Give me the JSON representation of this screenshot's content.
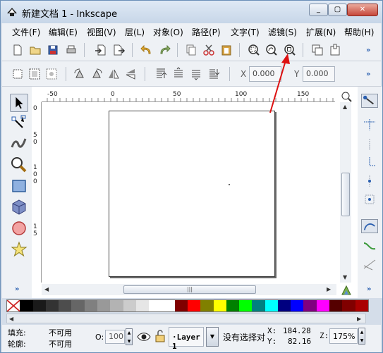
{
  "window": {
    "title": "新建文档 1 - Inkscape"
  },
  "window_buttons": {
    "minimize": "_",
    "maximize": "▢",
    "close": "✕"
  },
  "menu": [
    {
      "label": "文件(F)"
    },
    {
      "label": "编辑(E)"
    },
    {
      "label": "视图(V)"
    },
    {
      "label": "层(L)"
    },
    {
      "label": "对象(O)"
    },
    {
      "label": "路径(P)"
    },
    {
      "label": "文字(T)"
    },
    {
      "label": "滤镜(S)"
    },
    {
      "label": "扩展(N)"
    },
    {
      "label": "帮助(H)"
    }
  ],
  "toolbar_more": "»",
  "controls": {
    "x_label": "X",
    "x_value": "0.000",
    "y_label": "Y",
    "y_value": "0.000"
  },
  "rulers": {
    "horizontal": [
      "-50",
      "0",
      "50",
      "100",
      "150"
    ],
    "vertical": [
      "0",
      "5",
      "0",
      "1",
      "0",
      "0",
      "1",
      "5"
    ]
  },
  "status": {
    "fill_label": "填充:",
    "fill_value": "不可用",
    "stroke_label": "轮廓:",
    "stroke_value": "不可用",
    "opacity_label": "O:",
    "opacity_value": "100",
    "layer_name": "·Layer 1",
    "message": "没有选择对",
    "x_label": "X:",
    "x_coord": "184.28",
    "y_label": "Y:",
    "y_coord": "82.16",
    "zoom_label": "Z:",
    "zoom_value": "175%"
  },
  "palette_colors": [
    "#000000",
    "#1a1a1a",
    "#333333",
    "#4d4d4d",
    "#666666",
    "#808080",
    "#999999",
    "#b3b3b3",
    "#cccccc",
    "#e6e6e6",
    "#ffffff",
    "#ffffff",
    "#800000",
    "#ff0000",
    "#808000",
    "#ffff00",
    "#008000",
    "#00ff00",
    "#008080",
    "#00ffff",
    "#000080",
    "#0000ff",
    "#800080",
    "#ff00ff",
    "#550000",
    "#800000",
    "#aa0000"
  ],
  "colors": {
    "annotation_arrow": "#dd1111",
    "accent": "#2a5fb0"
  }
}
